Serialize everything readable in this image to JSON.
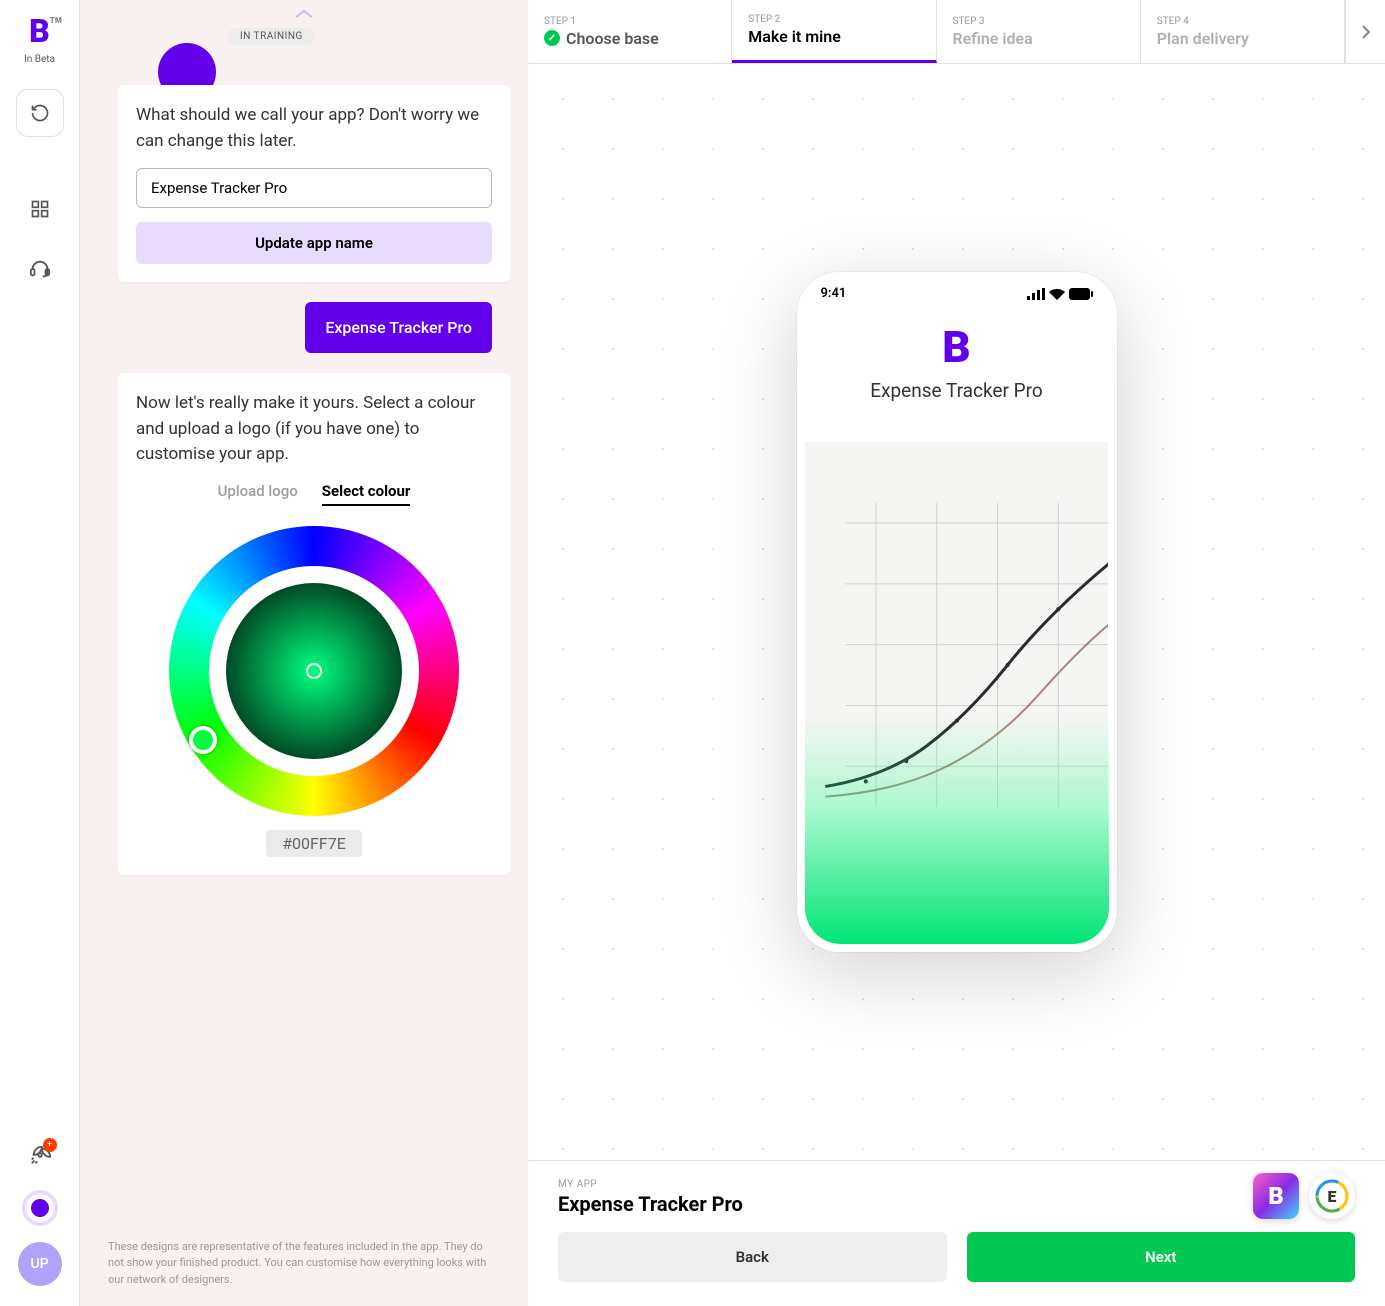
{
  "rail": {
    "beta_label": "In Beta",
    "avatar_initials": "UP",
    "rocket_badge": "+"
  },
  "chat": {
    "training_badge": "IN TRAINING",
    "card1_text": "What should we call your app? Don't worry we can change this later.",
    "card1_input_value": "Expense Tracker Pro",
    "card1_button": "Update app name",
    "user_reply": "Expense Tracker Pro",
    "card2_text": "Now let's really make it yours. Select a colour and upload a logo (if you have one) to customise your app.",
    "tab_upload": "Upload logo",
    "tab_colour": "Select colour",
    "hex_value": "#00FF7E",
    "disclaimer": "These designs are representative of the features included in the app. They do not show your finished product. You can customise how everything looks with our network of designers."
  },
  "steps": [
    {
      "label": "STEP 1",
      "title": "Choose base",
      "state": "done"
    },
    {
      "label": "STEP 2",
      "title": "Make it mine",
      "state": "active"
    },
    {
      "label": "STEP 3",
      "title": "Refine idea",
      "state": "future"
    },
    {
      "label": "STEP 4",
      "title": "Plan delivery",
      "state": "future"
    }
  ],
  "phone": {
    "time": "9:41",
    "app_name": "Expense Tracker Pro"
  },
  "footer": {
    "label": "MY APP",
    "title": "Expense Tracker Pro",
    "back": "Back",
    "next": "Next"
  }
}
